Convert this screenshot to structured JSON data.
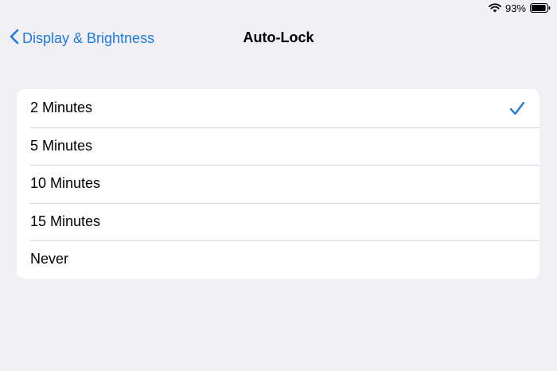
{
  "status_bar": {
    "battery_percent": "93%",
    "battery_level": 0.93,
    "icons": [
      "wifi-icon",
      "battery-icon"
    ]
  },
  "nav": {
    "back_label": "Display & Brightness",
    "title": "Auto-Lock"
  },
  "options": [
    {
      "label": "2 Minutes",
      "selected": true
    },
    {
      "label": "5 Minutes",
      "selected": false
    },
    {
      "label": "10 Minutes",
      "selected": false
    },
    {
      "label": "15 Minutes",
      "selected": false
    },
    {
      "label": "Never",
      "selected": false
    }
  ],
  "colors": {
    "accent": "#1f7ae0",
    "background": "#f0f0f5",
    "card": "#ffffff",
    "separator": "#d6d6da"
  }
}
